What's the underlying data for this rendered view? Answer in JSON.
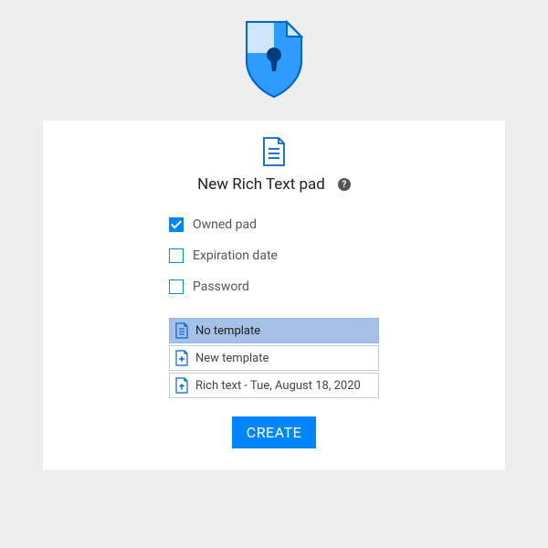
{
  "title": "New Rich Text pad",
  "options": {
    "owned": {
      "label": "Owned pad",
      "checked": true
    },
    "expiration": {
      "label": "Expiration date",
      "checked": false
    },
    "password": {
      "label": "Password",
      "checked": false
    }
  },
  "templates": [
    {
      "label": "No template",
      "selected": true,
      "icon": "doc"
    },
    {
      "label": "New template",
      "selected": false,
      "icon": "new"
    },
    {
      "label": "Rich text - Tue, August 18, 2020",
      "selected": false,
      "icon": "upload"
    }
  ],
  "create_button": "CREATE",
  "colors": {
    "accent": "#0087ff",
    "selected": "#a6c1e7"
  }
}
